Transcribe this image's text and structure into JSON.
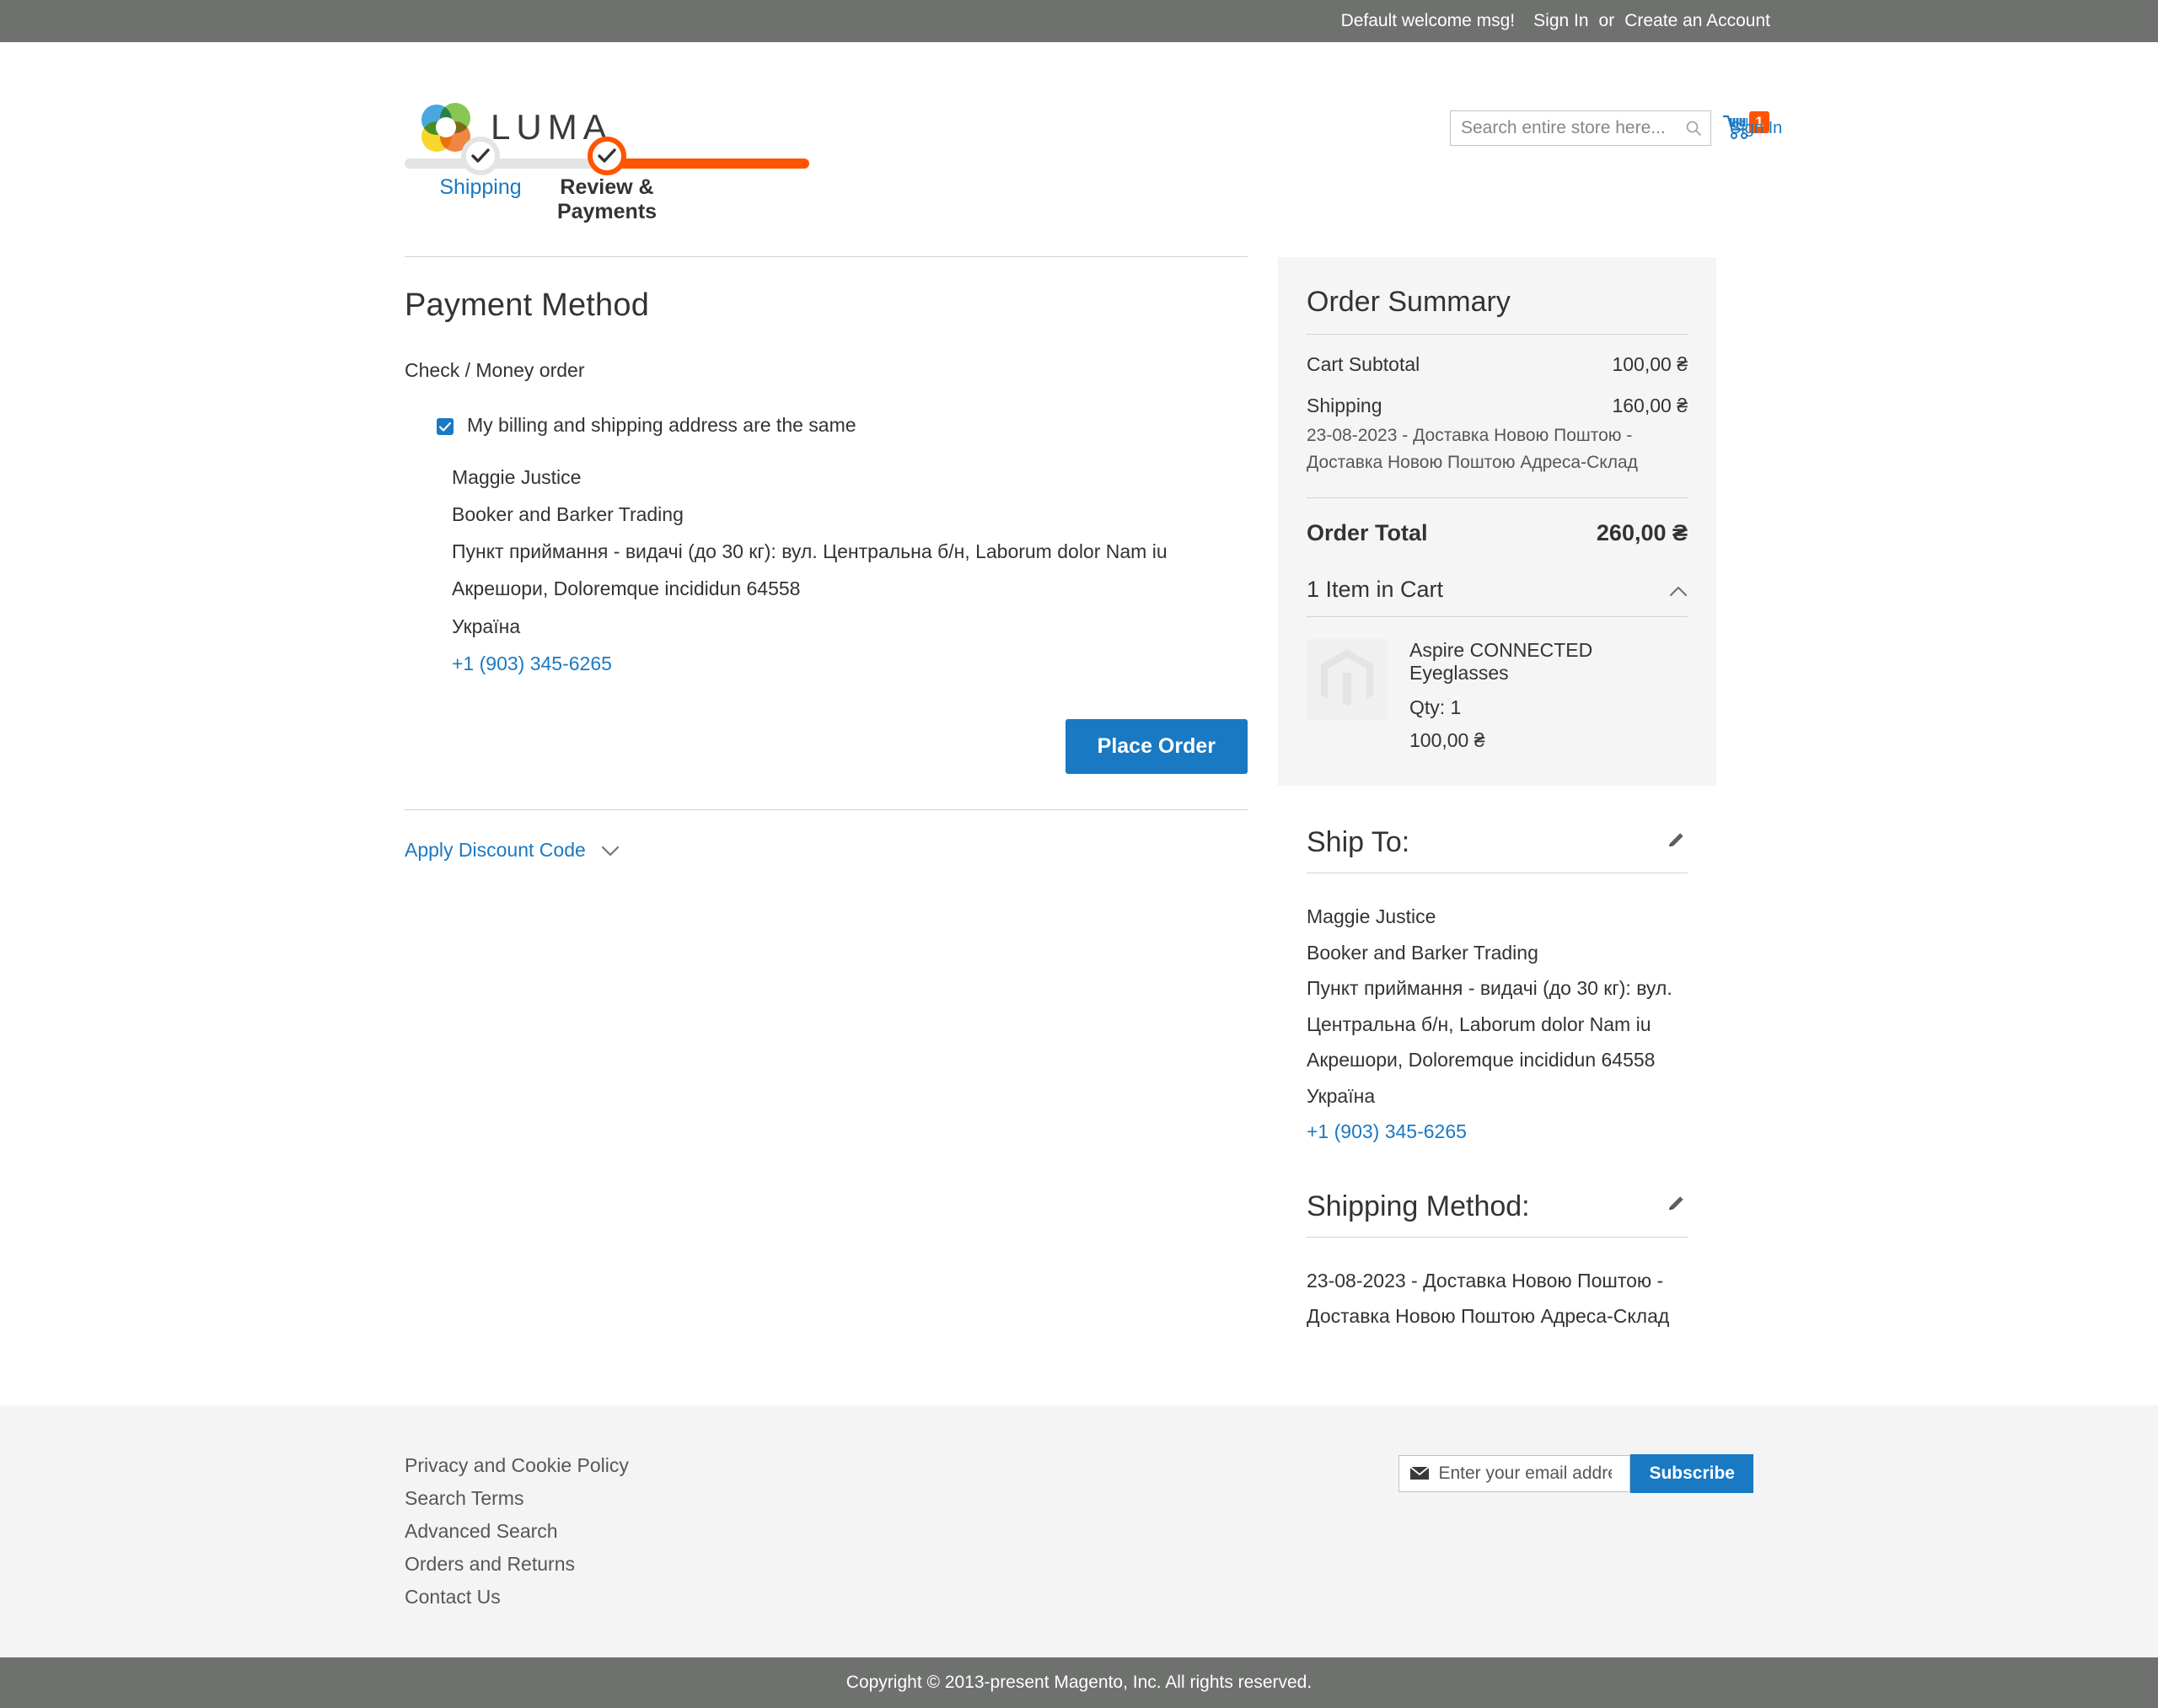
{
  "top_panel": {
    "welcome": "Default welcome msg!",
    "sign_in": "Sign In",
    "separator": "or",
    "create_account": "Create an Account"
  },
  "header": {
    "logo_text": "LUMA",
    "search_placeholder": "Search entire store here...",
    "search_value": "",
    "cart_count": "1",
    "cart_overlay_text": "Sign In"
  },
  "progress": {
    "step_shipping": "Shipping",
    "step_review": "Review & Payments"
  },
  "main": {
    "section_title": "Payment Method",
    "payment_method_name": "Check / Money order",
    "billing_same_label": "My billing and shipping address are the same",
    "billing_address": [
      "Maggie Justice",
      "Booker and Barker Trading",
      "Пункт приймання - видачі (до 30 кг): вул. Центральна б/н, Laborum dolor Nam iu",
      "Акрешори, Doloremque incididun 64558",
      "Україна"
    ],
    "billing_phone": "+1 (903) 345-6265",
    "place_order_label": "Place Order",
    "apply_discount_label": "Apply Discount Code"
  },
  "summary": {
    "title": "Order Summary",
    "cart_subtotal_label": "Cart Subtotal",
    "cart_subtotal_value": "100,00 ₴",
    "shipping_label": "Shipping",
    "shipping_value": "160,00 ₴",
    "shipping_description": "23-08-2023 - Доставка Новою Поштою - Доставка Новою Поштою Адреса-Склад",
    "order_total_label": "Order Total",
    "order_total_value": "260,00 ₴",
    "items_header": "1 Item in Cart",
    "item": {
      "name": "Aspire CONNECTED Eyeglasses",
      "qty": "Qty: 1",
      "price": "100,00 ₴"
    }
  },
  "ship_to": {
    "title": "Ship To:",
    "address": [
      "Maggie Justice",
      "Booker and Barker Trading",
      "Пункт приймання - видачі (до 30 кг): вул. Центральна б/н, Laborum dolor Nam iu",
      "Акрешори, Doloremque incididun 64558",
      "Україна"
    ],
    "phone": "+1 (903) 345-6265"
  },
  "shipping_method": {
    "title": "Shipping Method:",
    "value": "23-08-2023 - Доставка Новою Поштою - Доставка Новою Поштою Адреса-Склад"
  },
  "footer": {
    "links": [
      "Privacy and Cookie Policy",
      "Search Terms",
      "Advanced Search",
      "Orders and Returns",
      "Contact Us"
    ],
    "newsletter_placeholder": "Enter your email address",
    "newsletter_value": "",
    "subscribe_label": "Subscribe",
    "copyright": "Copyright © 2013-present Magento, Inc. All rights reserved."
  },
  "colors": {
    "accent_orange": "#ff5501",
    "link_blue": "#1979c3",
    "panel_gray": "#6e716e",
    "summary_bg": "#f5f5f5"
  }
}
